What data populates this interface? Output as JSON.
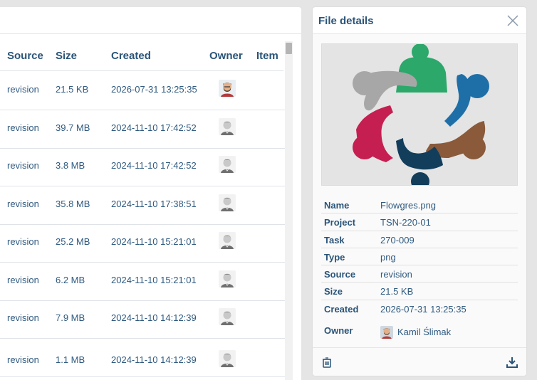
{
  "table": {
    "columns": [
      "Source",
      "Size",
      "Created",
      "Owner",
      "Item"
    ],
    "rows": [
      {
        "source": "revision",
        "size": "21.5 KB",
        "created": "2026-07-31 13:25:35",
        "owner_avatar": "bearded"
      },
      {
        "source": "revision",
        "size": "39.7 MB",
        "created": "2024-11-10 17:42:52",
        "owner_avatar": "photo"
      },
      {
        "source": "revision",
        "size": "3.8 MB",
        "created": "2024-11-10 17:42:52",
        "owner_avatar": "photo"
      },
      {
        "source": "revision",
        "size": "35.8 MB",
        "created": "2024-11-10 17:38:51",
        "owner_avatar": "photo"
      },
      {
        "source": "revision",
        "size": "25.2 MB",
        "created": "2024-11-10 15:21:01",
        "owner_avatar": "photo"
      },
      {
        "source": "revision",
        "size": "6.2 MB",
        "created": "2024-11-10 15:21:01",
        "owner_avatar": "photo"
      },
      {
        "source": "revision",
        "size": "7.9 MB",
        "created": "2024-11-10 14:12:39",
        "owner_avatar": "photo"
      },
      {
        "source": "revision",
        "size": "1.1 MB",
        "created": "2024-11-10 14:12:39",
        "owner_avatar": "photo"
      }
    ]
  },
  "details_panel": {
    "title": "File details",
    "close_icon": "close-icon",
    "fields": [
      {
        "label": "Name",
        "value": "Flowgres.png"
      },
      {
        "label": "Project",
        "value": "TSN-220-01"
      },
      {
        "label": "Task",
        "value": "270-009"
      },
      {
        "label": "Type",
        "value": "png"
      },
      {
        "label": "Source",
        "value": "revision"
      },
      {
        "label": "Size",
        "value": "21.5 KB"
      },
      {
        "label": "Created",
        "value": "2026-07-31 13:25:35"
      }
    ],
    "owner": {
      "label": "Owner",
      "name": "Kamil Ślimak"
    },
    "footer": {
      "delete_icon": "trash-icon",
      "download_icon": "download-icon"
    }
  },
  "colors": {
    "text_primary": "#2a5478",
    "logo_green": "#2ba86a",
    "logo_blue": "#1e6fa8",
    "logo_brown": "#8a5a3b",
    "logo_navy": "#123e5c",
    "logo_crimson": "#c51f52",
    "logo_gray": "#a7a7a7"
  }
}
